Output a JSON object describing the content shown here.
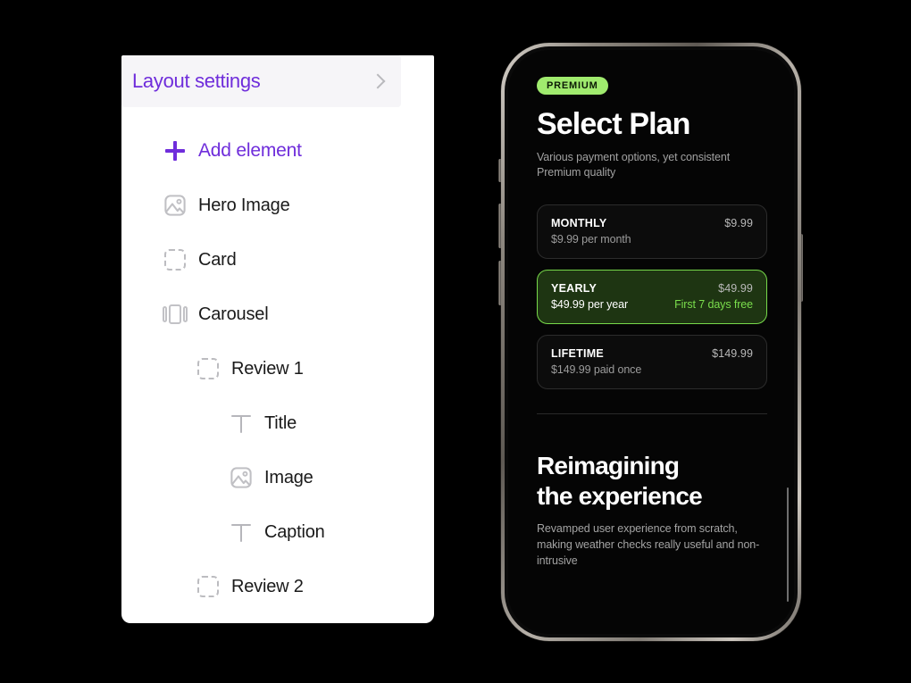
{
  "layers_panel": {
    "header": {
      "label": "Layout settings",
      "icon": "chevron-right-icon",
      "accent_color": "#6f2ddb",
      "background": "#f6f5f8"
    },
    "add_element": {
      "label": "Add element",
      "icon": "plus-icon"
    },
    "items": [
      {
        "label": "Hero Image",
        "icon": "image-icon",
        "indent": 0
      },
      {
        "label": "Card",
        "icon": "dashed-box-icon",
        "indent": 0
      },
      {
        "label": "Carousel",
        "icon": "carousel-icon",
        "indent": 0
      },
      {
        "label": "Review 1",
        "icon": "dashed-box-icon",
        "indent": 1
      },
      {
        "label": "Title",
        "icon": "text-icon",
        "indent": 2
      },
      {
        "label": "Image",
        "icon": "image-icon",
        "indent": 2
      },
      {
        "label": "Caption",
        "icon": "text-icon",
        "indent": 2
      },
      {
        "label": "Review 2",
        "icon": "dashed-box-icon",
        "indent": 1
      }
    ]
  },
  "phone": {
    "hardware": {
      "silent_switch": "silent-switch-button",
      "volume_up": "volume-up-button",
      "volume_down": "volume-down-button",
      "power": "power-button"
    },
    "screen": {
      "badge": "PREMIUM",
      "badge_color": "#a0eb6e",
      "title": "Select Plan",
      "subtitle": "Various payment options, yet consistent Premium quality",
      "plans": [
        {
          "name": "MONTHLY",
          "price": "$9.99",
          "sub": "$9.99 per month",
          "note": "",
          "selected": false
        },
        {
          "name": "YEARLY",
          "price": "$49.99",
          "sub": "$49.99 per year",
          "note": "First 7 days free",
          "selected": true
        },
        {
          "name": "LIFETIME",
          "price": "$149.99",
          "sub": "$149.99 paid once",
          "note": "",
          "selected": false
        }
      ],
      "feature": {
        "title_line1": "Reimagining",
        "title_line2": "the experience",
        "body": "Revamped user experience from scratch, making weather checks really useful and non-intrusive"
      },
      "selected_accent": "#77d94a",
      "selected_background": "#1e3512"
    }
  }
}
